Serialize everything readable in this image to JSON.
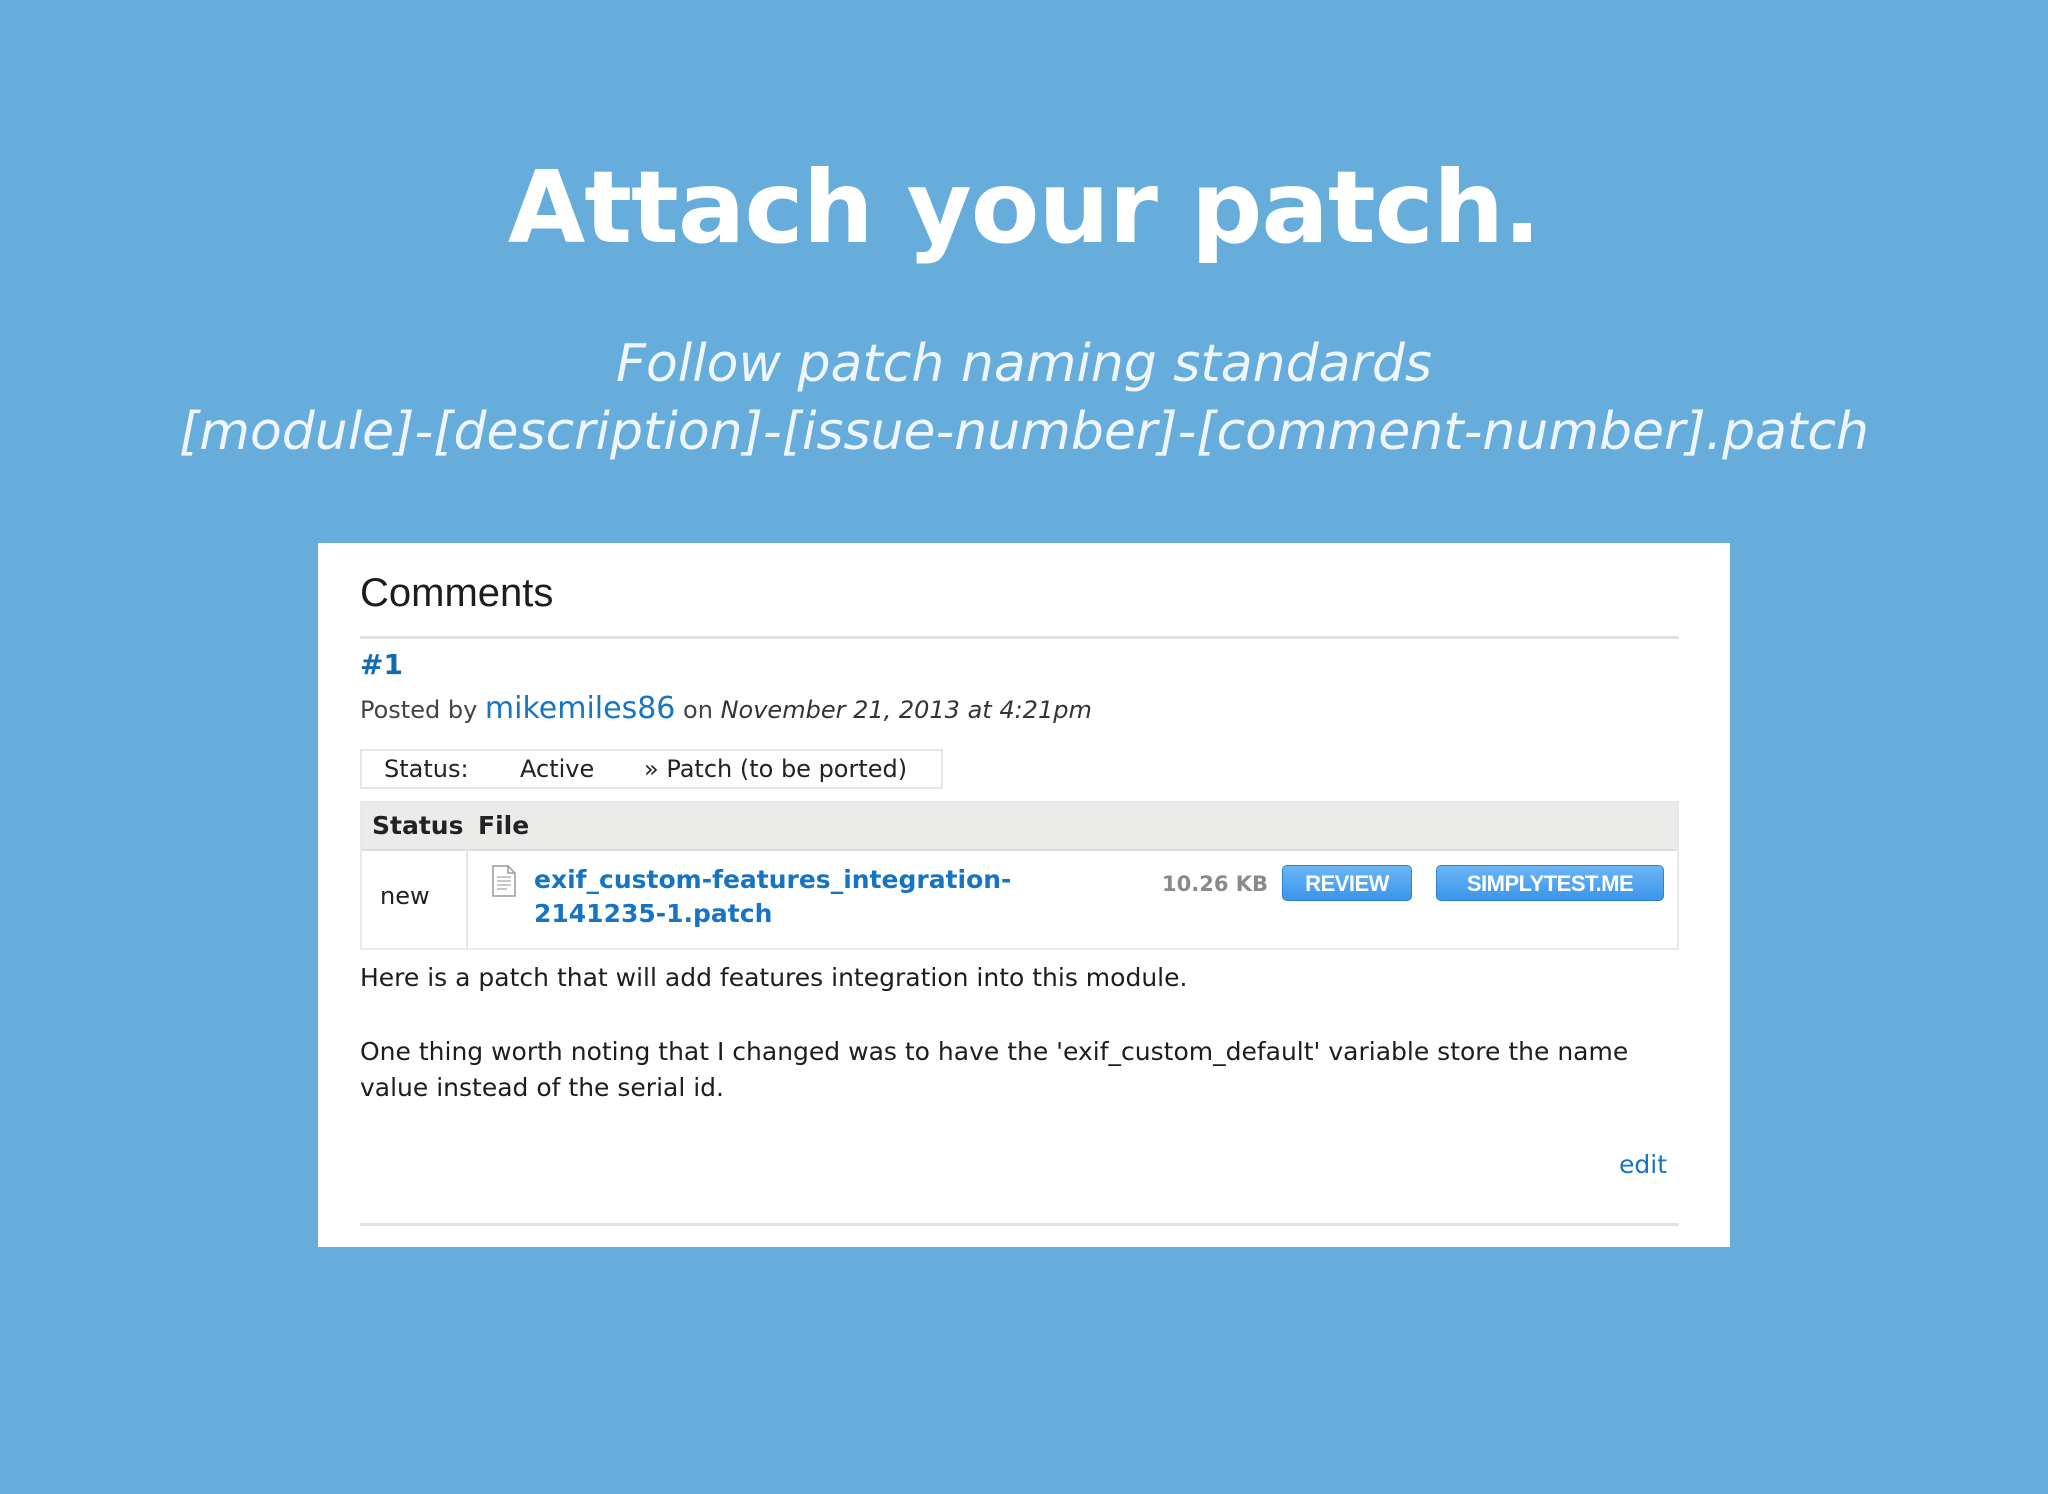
{
  "slide": {
    "title": "Attach your patch.",
    "subtitle_line1": "Follow patch naming standards",
    "subtitle_line2": "[module]-[description]-[issue-number]-[comment-number].patch"
  },
  "comments": {
    "heading": "Comments",
    "comment_number": "#1",
    "posted_by_prefix": "Posted by",
    "author": "mikemiles86",
    "on_text": "on",
    "date": "November 21, 2013 at 4:21pm",
    "status_label": "Status:",
    "status_value": "Active",
    "status_change": "» Patch (to be ported)",
    "files_table": {
      "headers": [
        "Status",
        "File"
      ],
      "rows": [
        {
          "status": "new",
          "file_name": "exif_custom-features_integration-2141235-1.patch",
          "file_size": "10.26 KB",
          "review_label": "REVIEW",
          "simplytest_label": "SIMPLYTEST.ME"
        }
      ]
    },
    "paragraph1": "Here is a patch that will add features integration into this module.",
    "paragraph2": "One thing worth noting that I changed was to have the 'exif_custom_default' variable store the name value instead of the serial id.",
    "edit_label": "edit"
  },
  "colors": {
    "background": "#66addb",
    "link": "#1574c3",
    "button": "#3b95ea"
  },
  "icons": {
    "file": "document-icon"
  }
}
